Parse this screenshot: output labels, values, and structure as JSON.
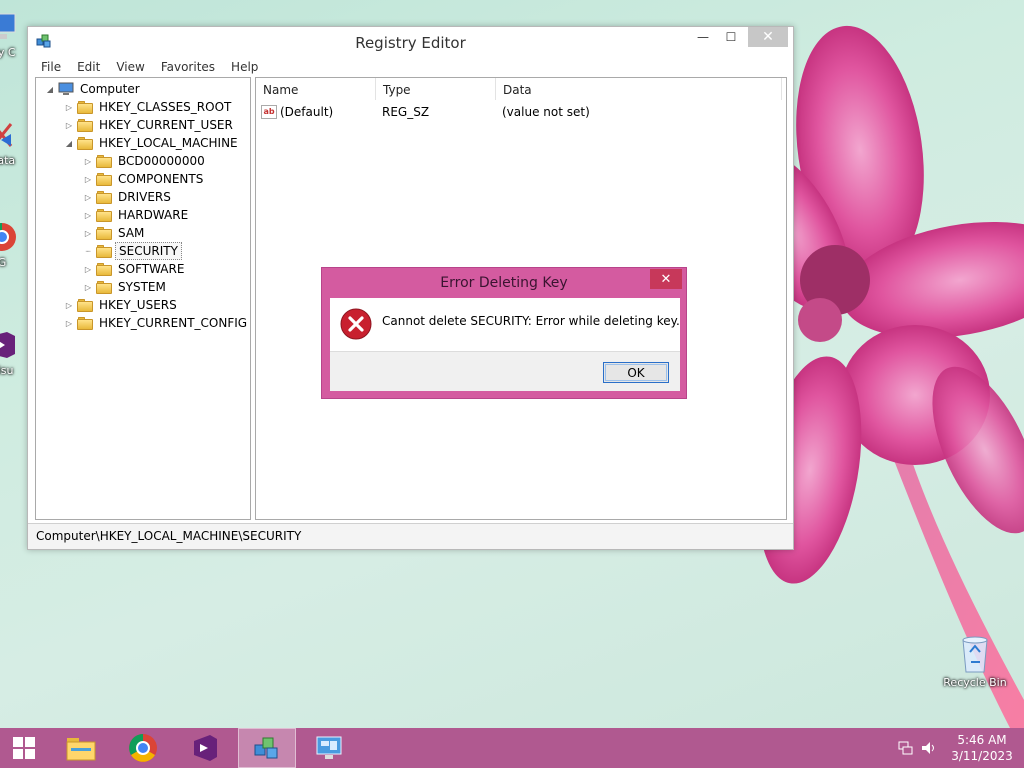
{
  "desktop": {
    "icons": [
      {
        "label": "My C"
      },
      {
        "label": "Data"
      },
      {
        "label": "G"
      },
      {
        "label": "Visu"
      }
    ],
    "recycle_bin": "Recycle Bin"
  },
  "window": {
    "title": "Registry Editor",
    "controls": {
      "minimize": "—",
      "maximize": "☐",
      "close": "✕"
    },
    "menu": [
      "File",
      "Edit",
      "View",
      "Favorites",
      "Help"
    ],
    "tree": {
      "root": "Computer",
      "hives": [
        "HKEY_CLASSES_ROOT",
        "HKEY_CURRENT_USER",
        "HKEY_LOCAL_MACHINE",
        "HKEY_USERS",
        "HKEY_CURRENT_CONFIG"
      ],
      "hklm_children": [
        "BCD00000000",
        "COMPONENTS",
        "DRIVERS",
        "HARDWARE",
        "SAM",
        "SECURITY",
        "SOFTWARE",
        "SYSTEM"
      ],
      "selected": "SECURITY"
    },
    "list": {
      "columns": [
        "Name",
        "Type",
        "Data"
      ],
      "rows": [
        {
          "name": "(Default)",
          "type": "REG_SZ",
          "data": "(value not set)",
          "icon": "ab"
        }
      ]
    },
    "status": "Computer\\HKEY_LOCAL_MACHINE\\SECURITY"
  },
  "dialog": {
    "title": "Error Deleting Key",
    "close": "✕",
    "message": "Cannot delete SECURITY:  Error while deleting key.",
    "ok_label": "OK"
  },
  "taskbar": {
    "time": "5:46 AM",
    "date": "3/11/2023",
    "colors": {
      "taskbar": "#b05990",
      "dialog_frame": "#d45ba0"
    }
  }
}
